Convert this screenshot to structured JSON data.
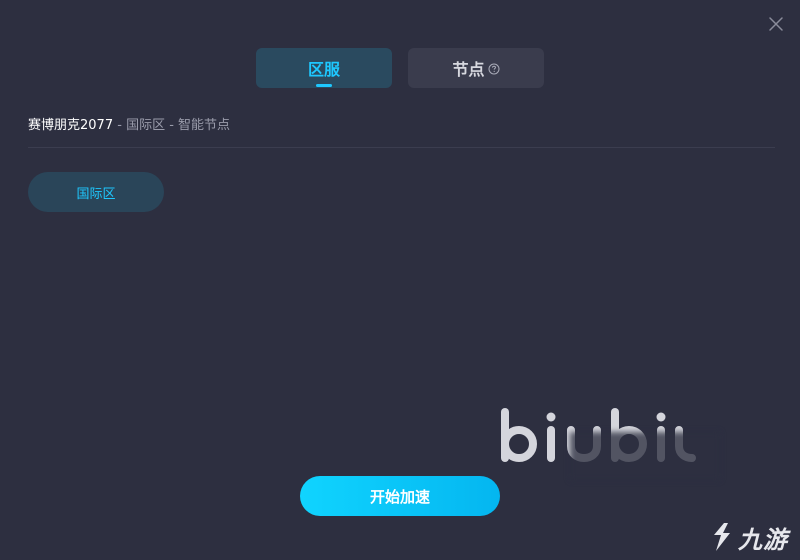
{
  "window": {
    "close_icon": "close-icon"
  },
  "tabs": [
    {
      "label": "区服",
      "active": true
    },
    {
      "label": "节点",
      "active": false,
      "icon": "help-circle-icon"
    }
  ],
  "breadcrumb": {
    "game": "赛博朋克2077",
    "separator": "-",
    "region": "国际区",
    "node": "智能节点"
  },
  "regions": [
    {
      "label": "国际区",
      "selected": true
    }
  ],
  "start_button": {
    "label": "开始加速"
  },
  "watermarks": {
    "center_logo_icon": "biubiu-logo-icon",
    "corner_logo_text": "九游",
    "corner_logo_icon": "jiuyou-logo-icon"
  },
  "colors": {
    "background": "#2d2f40",
    "accent": "#1ec8ff",
    "tab_active_bg": "#2a4a5f",
    "tab_inactive_bg": "#3a3c4d",
    "button_gradient_start": "#10d4ff",
    "button_gradient_end": "#04b6f0"
  }
}
